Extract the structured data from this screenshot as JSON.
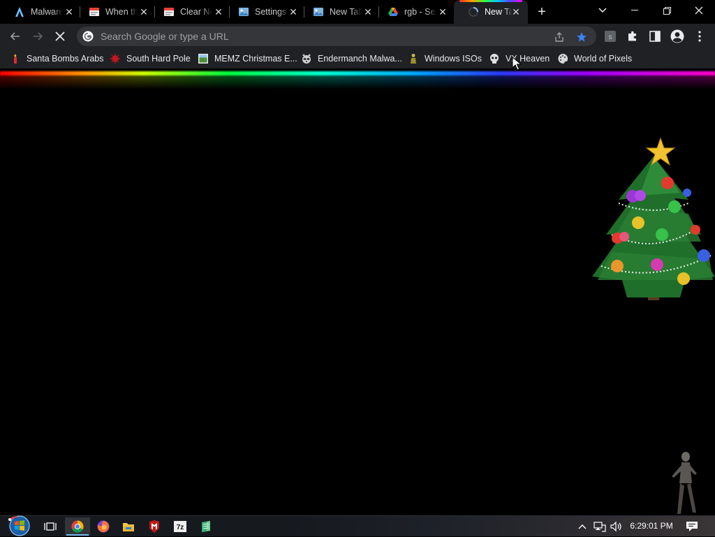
{
  "tabs": [
    {
      "title": "Malware",
      "icon": "aurora-icon"
    },
    {
      "title": "When the",
      "icon": "sheet-icon"
    },
    {
      "title": "Clear New",
      "icon": "sheet-icon"
    },
    {
      "title": "Settings",
      "icon": "image-icon"
    },
    {
      "title": "New Tab",
      "icon": "image-icon"
    },
    {
      "title": "rgb - Search",
      "icon": "drive-icon"
    },
    {
      "title": "New Tab",
      "icon": "loading-spinner-icon",
      "active": true
    }
  ],
  "omnibox": {
    "placeholder": "Search Google or type a URL",
    "value": ""
  },
  "bookmarks": [
    {
      "label": "Santa Bombs Arabs",
      "icon": "candle-icon"
    },
    {
      "label": "South Hard Pole",
      "icon": "virus-icon"
    },
    {
      "label": "MEMZ Christmas E...",
      "icon": "picture-icon"
    },
    {
      "label": "Endermanch Malwa...",
      "icon": "raccoon-icon"
    },
    {
      "label": "Windows ISOs",
      "icon": "figure-icon"
    },
    {
      "label": "VX Heaven",
      "icon": "skull-icon"
    },
    {
      "label": "World of Pixels",
      "icon": "palette-icon"
    }
  ],
  "taskbar": {
    "apps": [
      "chrome-icon",
      "firefox-icon",
      "file-explorer-icon",
      "mcafee-icon",
      "7zip-icon",
      "notepad-icon"
    ],
    "clock": "6:29:01 PM"
  },
  "colors": {
    "tab_bg": "#000000",
    "toolbar_bg": "#202124",
    "omnibox_bg": "#35363a",
    "bookmark_star": "#8ab4f8",
    "content_bg": "#000000"
  }
}
